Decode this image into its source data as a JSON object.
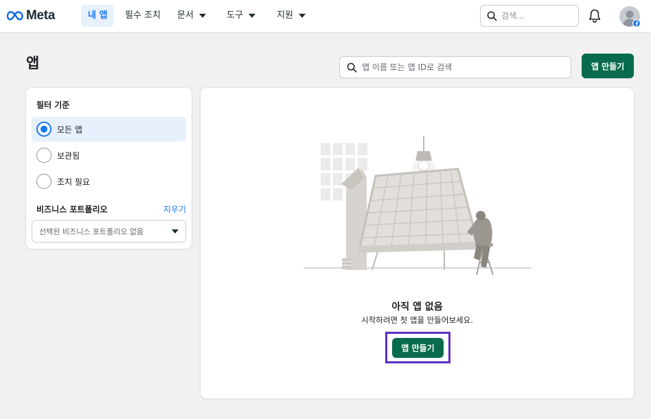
{
  "nav": {
    "logo": "Meta",
    "items": [
      {
        "label": "내 앱"
      },
      {
        "label": "필수 조치"
      },
      {
        "label": "문서"
      },
      {
        "label": "도구"
      },
      {
        "label": "지원"
      }
    ],
    "search_placeholder": "검색...",
    "icons": {
      "search": "search-icon",
      "bell": "bell-icon",
      "avatar": "avatar-icon",
      "badge": "facebook-badge-icon"
    }
  },
  "page": {
    "title": "앱",
    "search_placeholder": "앱 이름 또는 앱 ID로 검색",
    "create_button": "앱 만들기"
  },
  "filter": {
    "title": "필터 기준",
    "options": [
      {
        "label": "모든 앱",
        "selected": true
      },
      {
        "label": "보관됨",
        "selected": false
      },
      {
        "label": "조치 필요",
        "selected": false
      }
    ],
    "portfolio_label": "비즈니스 포트폴리오",
    "clear_label": "지우기",
    "portfolio_select": "선택된 비즈니스 포트폴리오 없음"
  },
  "empty_state": {
    "title": "아직 앱 없음",
    "subtitle": "시작하려면 첫 앱을 만들어보세요.",
    "create_button": "앱 만들기",
    "highlight_color": "#5c2fc2"
  },
  "colors": {
    "primary_button": "#086b4d",
    "accent_blue": "#1877f2",
    "page_bg": "#f1f1f1"
  }
}
